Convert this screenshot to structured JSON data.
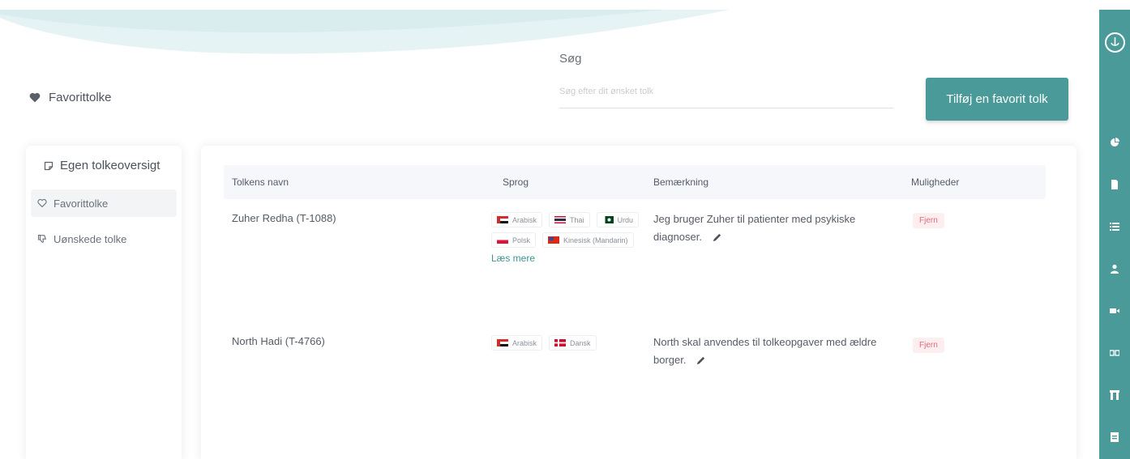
{
  "page": {
    "heading": "Favorittolke"
  },
  "search": {
    "label": "Søg",
    "placeholder": "Søg efter dit ønsket tolk",
    "value": ""
  },
  "actions": {
    "add_favorite": "Tilføj en favorit tolk"
  },
  "sidebar": {
    "title": "Egen tolkeoversigt",
    "items": [
      {
        "label": "Favorittolke",
        "active": true
      },
      {
        "label": "Uønskede tolke",
        "active": false
      }
    ]
  },
  "table": {
    "headers": [
      "Tolkens navn",
      "Sprog",
      "Bemærkning",
      "Muligheder"
    ],
    "rows": [
      {
        "name": "Zuher Redha (T-1088)",
        "languages": [
          "Arabisk",
          "Thai",
          "Urdu",
          "Polsk",
          "Kinesisk (Mandarin)"
        ],
        "more": "Læs mere",
        "note": "Jeg bruger Zuher til patienter med psykiske diagnoser.",
        "action": "Fjern"
      },
      {
        "name": "North Hadi (T-4766)",
        "languages": [
          "Arabisk",
          "Dansk"
        ],
        "note": "North skal anvendes til tolkeopgaver med ældre borger.",
        "action": "Fjern"
      }
    ]
  },
  "nav_icons": [
    "logo-icon",
    "chart-icon",
    "document-icon",
    "list-icon",
    "user-icon",
    "video-icon",
    "translate-icon",
    "building-icon",
    "calendar-icon"
  ],
  "colors": {
    "accent": "#4a9a9a",
    "danger_text": "#e06a7a",
    "danger_bg": "#fdeef0"
  }
}
